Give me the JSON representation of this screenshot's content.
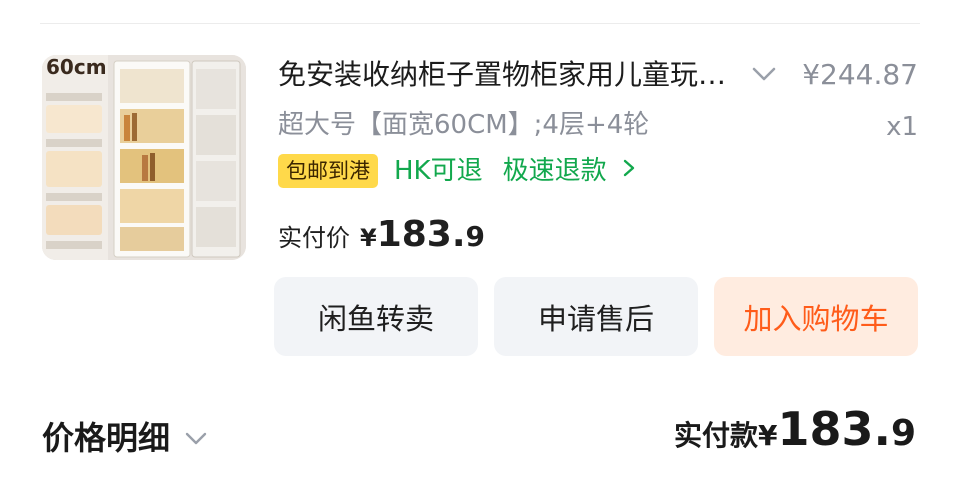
{
  "item": {
    "thumb_badge": "60cm",
    "title": "免安装收纳柜子置物柜家用儿童玩具零食储物柜",
    "original_price": "¥244.87",
    "spec": "超大号【面宽60CM】;4层+4轮",
    "quantity": "x1",
    "tags": {
      "shipping": "包邮到港",
      "refund": "HK可退",
      "fast_refund": "极速退款"
    },
    "paid": {
      "label": "实付价",
      "currency": "¥",
      "integer": "183.",
      "decimal": "9"
    }
  },
  "actions": {
    "resell": "闲鱼转卖",
    "aftersale": "申请售后",
    "add_to_cart": "加入购物车"
  },
  "summary": {
    "detail_label": "价格明细",
    "total_label": "实付款",
    "currency": "¥",
    "integer": "183.",
    "decimal": "9"
  },
  "colors": {
    "accent_orange": "#ff5c1a",
    "cart_bg": "#ffece0",
    "green": "#12a84d",
    "tag_yellow": "#ffd94a",
    "gray_text": "#8b8f99",
    "button_bg": "#f2f4f7"
  },
  "icons": {
    "title_expand": "chevron-down-icon",
    "fast_refund": "chevron-right-icon",
    "detail_toggle": "chevron-down-icon"
  }
}
